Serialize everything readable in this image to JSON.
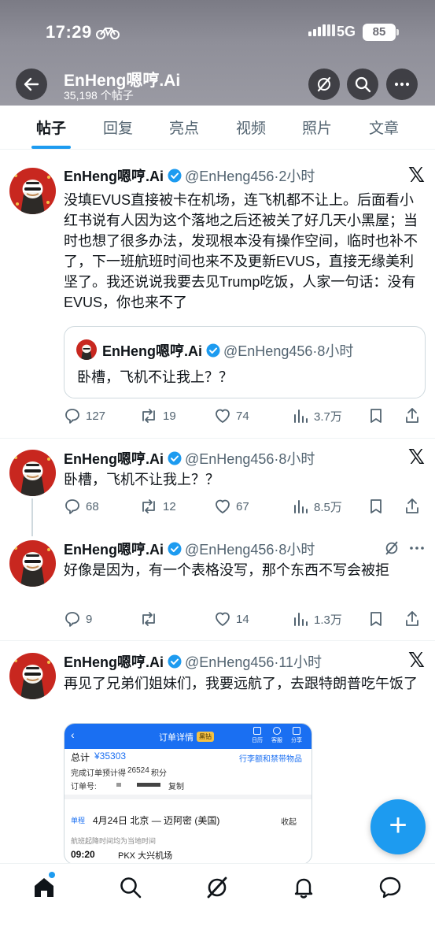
{
  "status_bar": {
    "time": "17:29",
    "network": "5G",
    "battery": "85"
  },
  "header": {
    "title": "EnHeng嗯哼.Ai",
    "subtitle": "35,198 个帖子"
  },
  "tabs": [
    {
      "label": "帖子",
      "active": true
    },
    {
      "label": "回复"
    },
    {
      "label": "亮点"
    },
    {
      "label": "视频"
    },
    {
      "label": "照片"
    },
    {
      "label": "文章"
    }
  ],
  "posts": [
    {
      "name": "EnHeng嗯哼.Ai",
      "handle": "@EnHeng456·2小时",
      "text": "没填EVUS直接被卡在机场，连飞机都不让上。后面看小红书说有人因为这个落地之后还被关了好几天小黑屋；当时也想了很多办法，发现根本没有操作空间，临时也补不了，下一班航班时间也来不及更新EVUS，直接无缘美利坚了。我还说说我要去见Trump吃饭，人家一句话：没有EVUS，你也来不了",
      "quote": {
        "name": "EnHeng嗯哼.Ai",
        "handle": "@EnHeng456·8小时",
        "text": "卧槽，飞机不让我上？？"
      },
      "replies": "127",
      "reposts": "19",
      "likes": "74",
      "views": "3.7万"
    },
    {
      "name": "EnHeng嗯哼.Ai",
      "handle": "@EnHeng456·8小时",
      "text": "卧槽，飞机不让我上？？",
      "replies": "68",
      "reposts": "12",
      "likes": "67",
      "views": "8.5万"
    },
    {
      "name": "EnHeng嗯哼.Ai",
      "handle": "@EnHeng456·8小时",
      "text": "好像是因为，有一个表格没写，那个东西不写会被拒",
      "replies": "9",
      "reposts": "",
      "likes": "14",
      "views": "1.3万"
    },
    {
      "name": "EnHeng嗯哼.Ai",
      "handle": "@EnHeng456·11小时",
      "text": "再见了兄弟们姐妹们，我要远航了，去跟特朗普吃午饭了",
      "image": {
        "header_title": "订单详情",
        "vip": "黑钻",
        "icons": [
          "日历",
          "客服",
          "分享"
        ],
        "total_label": "总计",
        "total_value": "¥35303",
        "luggage_link": "行李额和禁带物品",
        "points_prefix": "完成订单预计得",
        "points_value": "26524",
        "points_suffix": "积分",
        "order_no_label": "订单号:",
        "copy": "复制",
        "trip_tag": "单程",
        "route": "4月24日 北京 — 迈阿密 (美国)",
        "collapse": "收起",
        "note": "航班起降时间均为当地时间",
        "dep_time": "09:20",
        "dep_airport": "PKX 大兴机场"
      }
    }
  ],
  "colors": {
    "accent": "#1d9bf0",
    "text": "#0f1419",
    "muted": "#536471",
    "border": "#eff3f4"
  },
  "icons": {
    "back": "arrow-left-icon",
    "grok": "grok-icon",
    "search": "search-icon",
    "more": "more-icon",
    "x": "x-logo-icon"
  }
}
